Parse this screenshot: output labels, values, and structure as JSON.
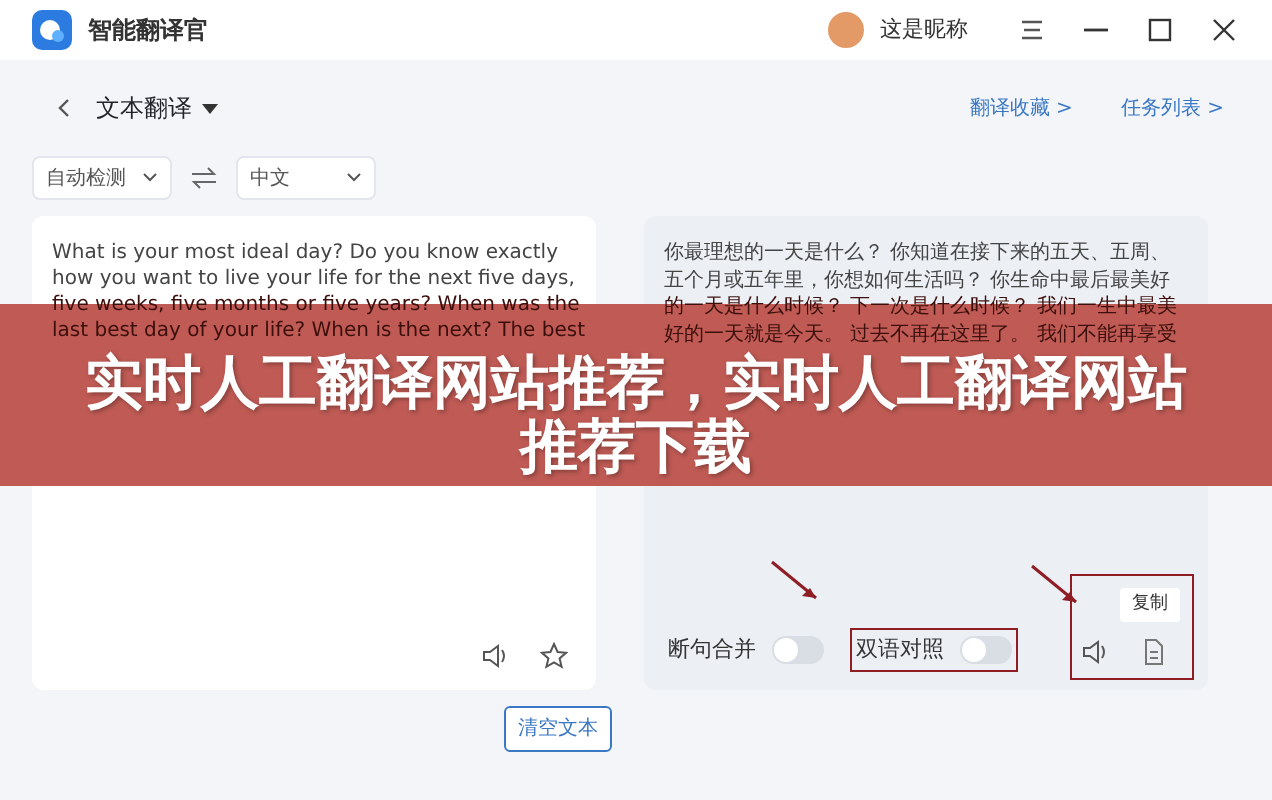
{
  "window": {
    "title": "智能翻译官",
    "user": "这是昵称"
  },
  "header": {
    "mode": "文本翻译",
    "links": [
      "翻译收藏 >",
      "任务列表 >"
    ]
  },
  "languages": {
    "source": "自动检测",
    "target": "中文"
  },
  "source_lines": [
    "What is your most ideal day? Do you know exactly",
    "how you want to live your life for the next five days,",
    "five weeks, five months or five years? When was the",
    "last best day of your life? When is the next? The best"
  ],
  "target_lines": [
    "你最理想的一天是什么？ 你知道在接下来的五天、五周、",
    "五个月或五年里，你想如何生活吗？ 你生命中最后最美好",
    "的一天是什么时候？ 下一次是什么时候？ 我们一生中最美",
    "好的一天就是今天。 过去不再在这里了。 我们不能再享受"
  ],
  "toggles": [
    {
      "label": "断句合并",
      "on": false,
      "annotated": false
    },
    {
      "label": "双语对照",
      "on": false,
      "annotated": true
    }
  ],
  "copy": {
    "tooltip": "复制",
    "annotated": true
  },
  "clear_button": "清空文本",
  "banner": "实时人工翻译网站推荐，实时人工翻译网站推荐下载"
}
